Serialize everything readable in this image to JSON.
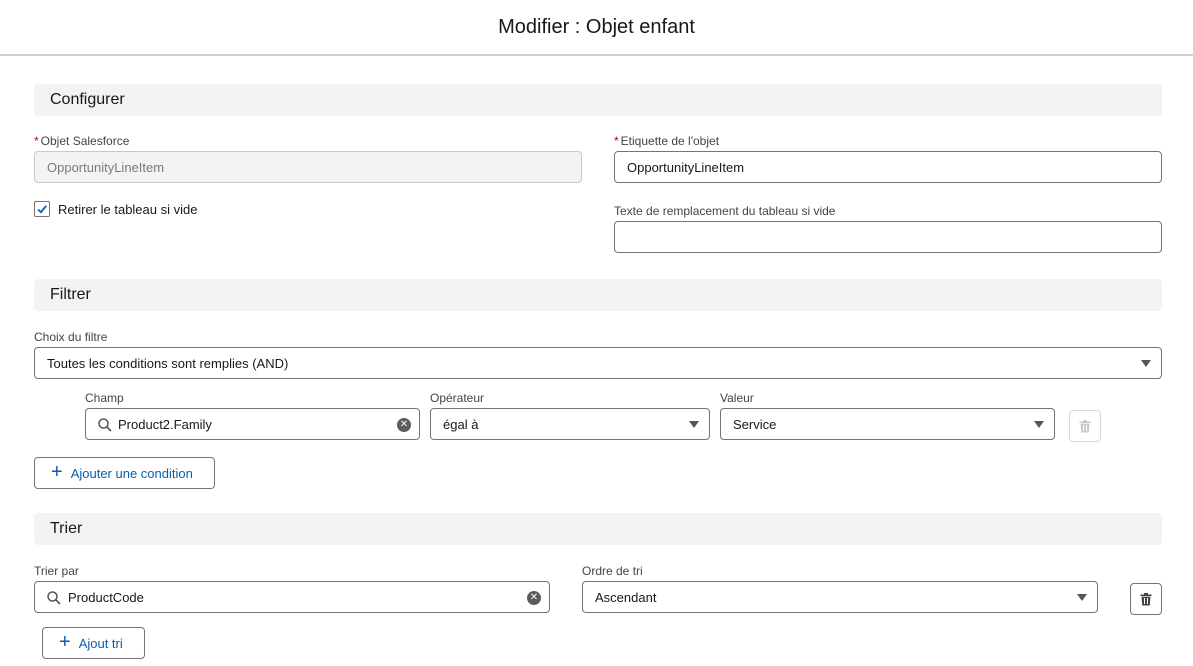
{
  "header": {
    "title": "Modifier : Objet enfant"
  },
  "configure": {
    "section_title": "Configurer",
    "salesforce_object": {
      "label": "Objet Salesforce",
      "value": "OpportunityLineItem",
      "required": "*"
    },
    "object_label": {
      "label": "Etiquette de l'objet",
      "value": "OpportunityLineItem",
      "required": "*"
    },
    "remove_if_empty": {
      "label": "Retirer le tableau si vide",
      "checked": true
    },
    "empty_placeholder": {
      "label": "Texte de remplacement du tableau si vide",
      "value": ""
    }
  },
  "filter": {
    "section_title": "Filtrer",
    "choice": {
      "label": "Choix du filtre",
      "value": "Toutes les conditions sont remplies (AND)"
    },
    "condition": {
      "field_label": "Champ",
      "field_value": "Product2.Family",
      "operator_label": "Opérateur",
      "operator_value": "égal à",
      "value_label": "Valeur",
      "value_value": "Service"
    },
    "add_condition_label": "Ajouter une condition"
  },
  "sort": {
    "section_title": "Trier",
    "sort_by": {
      "label": "Trier par",
      "value": "ProductCode"
    },
    "order": {
      "label": "Ordre de tri",
      "value": "Ascendant"
    },
    "add_sort_label": "Ajout tri"
  },
  "icons": {
    "search": "search-icon",
    "clear": "clear-icon",
    "caret": "chevron-down-icon",
    "delete": "trash-icon",
    "check": "check-icon",
    "plus": "plus-icon"
  },
  "colors": {
    "accent": "#0b5cab",
    "required": "#ba0517",
    "section_bg": "#f3f3f3"
  }
}
